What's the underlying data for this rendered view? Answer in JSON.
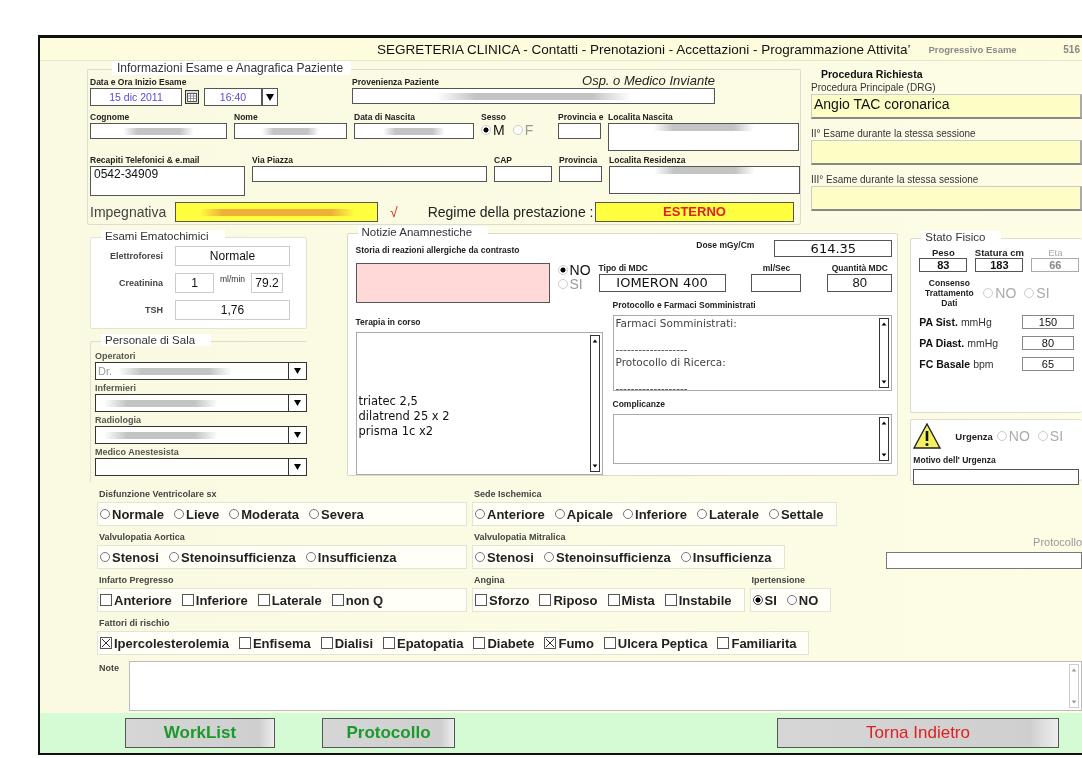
{
  "header": {
    "title": "SEGRETERIA CLINICA - Contatti - Prenotazioni - Accettazioni - Programmazione Attivita’",
    "counter_label": "Progressivo Esame",
    "counter_value": "516"
  },
  "patient": {
    "legend": "Informazioni Esame e Anagrafica Paziente",
    "exam_start": {
      "label": "Data e Ora Inizio Esame",
      "date": "15 dic 2011",
      "time": "16:40"
    },
    "origin": {
      "label": "Provenienza Paziente",
      "hint": "Osp. o Medico Inviante",
      "redacted": true
    },
    "surname": {
      "label": "Cognome",
      "redacted": true
    },
    "name": {
      "label": "Nome",
      "redacted": true
    },
    "birth_date": {
      "label": "Data di Nascita",
      "redacted": true
    },
    "sex": {
      "label": "Sesso",
      "options": [
        {
          "label": "M",
          "selected": true
        },
        {
          "label": "F",
          "selected": false
        }
      ]
    },
    "birth_province": {
      "label": "Provincia e"
    },
    "birth_place": {
      "label": "Localita Nascita",
      "redacted": true
    },
    "contacts": {
      "label": "Recapiti Telefonici  & e.mail",
      "value": "0542-34909"
    },
    "street": {
      "label": "Via Piazza"
    },
    "zip": {
      "label": "CAP"
    },
    "province": {
      "label": "Provincia"
    },
    "residence": {
      "label": "Localita Residenza",
      "redacted": true
    },
    "referral": {
      "label": "Impegnativa",
      "redacted": true,
      "mark": "√"
    },
    "regime": {
      "label": "Regime della prestazione :",
      "value": "ESTERNO"
    }
  },
  "procedure": {
    "title": "Procedura Richiesta",
    "fields": [
      {
        "label": "Procedura Principale (DRG)",
        "value": "Angio TAC coronarica"
      },
      {
        "label": "II° Esame durante la stessa sessione"
      },
      {
        "label": "III° Esame durante la stessa sessione"
      }
    ]
  },
  "labs": {
    "legend": "Esami Ematochimici",
    "electrophoresis": {
      "label": "Elettroforesi",
      "value": "Normale"
    },
    "creatinine": {
      "label": "Creatinina",
      "value": "1",
      "unit": "ml/min",
      "clearance": "79.2"
    },
    "tsh": {
      "label": "TSH",
      "value": "1,76"
    }
  },
  "staff": {
    "legend": "Personale di Sala",
    "selects": [
      {
        "label": "Operatori",
        "value": "Dr.",
        "redacted": true
      },
      {
        "label": "Infermieri",
        "redacted": true
      },
      {
        "label": "Radiologia",
        "redacted": true
      },
      {
        "label": "Medico Anestesista"
      }
    ]
  },
  "history": {
    "legend": "Notizie Anamnestiche",
    "allergy": {
      "label": "Storia di reazioni allergiche da contrasto",
      "options": [
        {
          "label": "NO",
          "selected": true
        },
        {
          "label": "SI",
          "selected": false
        }
      ]
    },
    "dose": {
      "label": "Dose mGy/Cm",
      "value": "614.35"
    },
    "contrast_type": {
      "label": "Tipo di MDC",
      "value": "IOMERON 400"
    },
    "flow": {
      "label": "ml/Sec"
    },
    "contrast_amount": {
      "label": "Quantità MDC",
      "value": "80"
    },
    "therapy": {
      "label": "Terapia in corso",
      "value": "\n\n\n\ntriatec 2,5\ndilatrend 25 x 2\nprisma 1c x2"
    },
    "drugs": {
      "label": "Protocollo e Farmaci Somministrati",
      "value": "Farmaci Somministrati:\n\n-------------------\nProtocollo di Ricerca:\n\n-------------------"
    },
    "complications": {
      "label": "Complicanze"
    }
  },
  "physical": {
    "legend": "Stato Fisico",
    "measures": [
      {
        "label": "Peso",
        "value": "83",
        "disabled": false
      },
      {
        "label": "Statura cm",
        "value": "183",
        "disabled": false
      },
      {
        "label": "Eta",
        "value": "66",
        "disabled": true
      }
    ],
    "consent": {
      "label": "Consenso Trattamento Dati",
      "disabled": true,
      "options": [
        {
          "label": "NO",
          "selected": false
        },
        {
          "label": "SI",
          "selected": false
        }
      ]
    },
    "vitals": [
      {
        "label": "PA Sist.",
        "unit": "mmHg",
        "value": "150"
      },
      {
        "label": "PA Diast.",
        "unit": "mmHg",
        "value": "80"
      },
      {
        "label": "FC Basale",
        "unit": "bpm",
        "value": "65"
      }
    ]
  },
  "urgency": {
    "label": "Urgenza",
    "disabled": true,
    "options": [
      {
        "label": "NO",
        "selected": false
      },
      {
        "label": "SI",
        "selected": false
      }
    ],
    "reason_label": "Motivo dell' Urgenza"
  },
  "clinical": {
    "rows": [
      [
        {
          "label": "Disfunzione Ventricolare sx",
          "kind": "radio",
          "options": [
            {
              "label": "Normale",
              "selected": false
            },
            {
              "label": "Lieve",
              "selected": false
            },
            {
              "label": "Moderata",
              "selected": false
            },
            {
              "label": "Severa",
              "selected": false
            }
          ]
        },
        {
          "label": "Sede Ischemica",
          "kind": "radio",
          "options": [
            {
              "label": "Anteriore",
              "selected": false
            },
            {
              "label": "Apicale",
              "selected": false
            },
            {
              "label": "Inferiore",
              "selected": false
            },
            {
              "label": "Laterale",
              "selected": false
            },
            {
              "label": "Settale",
              "selected": false
            }
          ]
        }
      ],
      [
        {
          "label": "Valvulopatia Aortica",
          "kind": "radio",
          "options": [
            {
              "label": "Stenosi",
              "selected": false
            },
            {
              "label": "Stenoinsufficienza",
              "selected": false
            },
            {
              "label": "Insufficienza",
              "selected": false
            }
          ]
        },
        {
          "label": "Valvulopatia Mitralica",
          "kind": "radio",
          "options": [
            {
              "label": "Stenosi",
              "selected": false
            },
            {
              "label": "Stenoinsufficienza",
              "selected": false
            },
            {
              "label": "Insufficienza",
              "selected": false
            }
          ]
        }
      ],
      [
        {
          "label": "Infarto Pregresso",
          "kind": "checkbox",
          "options": [
            {
              "label": "Anteriore",
              "checked": false
            },
            {
              "label": "Inferiore",
              "checked": false
            },
            {
              "label": "Laterale",
              "checked": false
            },
            {
              "label": "non Q",
              "checked": false
            }
          ]
        },
        {
          "label": "Angina",
          "kind": "checkbox",
          "options": [
            {
              "label": "Sforzo",
              "checked": false
            },
            {
              "label": "Riposo",
              "checked": false
            },
            {
              "label": "Mista",
              "checked": false
            },
            {
              "label": "Instabile",
              "checked": false
            }
          ]
        },
        {
          "label": "Ipertensione",
          "kind": "radio",
          "options": [
            {
              "label": "SI",
              "selected": true
            },
            {
              "label": "NO",
              "selected": false
            }
          ]
        }
      ],
      [
        {
          "label": "Fattori di rischio",
          "kind": "checkbox",
          "options": [
            {
              "label": "Ipercolesterolemia",
              "checked": true
            },
            {
              "label": "Enfisema",
              "checked": false
            },
            {
              "label": "Dialisi",
              "checked": false
            },
            {
              "label": "Epatopatia",
              "checked": false
            },
            {
              "label": "Diabete",
              "checked": false
            },
            {
              "label": "Fumo",
              "checked": true
            },
            {
              "label": "Ulcera Peptica",
              "checked": false
            },
            {
              "label": "Familiarita",
              "checked": false
            }
          ]
        }
      ]
    ]
  },
  "protocol": {
    "label": "Protocollo"
  },
  "notes": {
    "label": "Note"
  },
  "actions": [
    {
      "label": "WorkList",
      "kind": "nav"
    },
    {
      "label": "Protocollo",
      "kind": "nav"
    },
    {
      "label": "Torna Indietro",
      "kind": "back"
    }
  ]
}
